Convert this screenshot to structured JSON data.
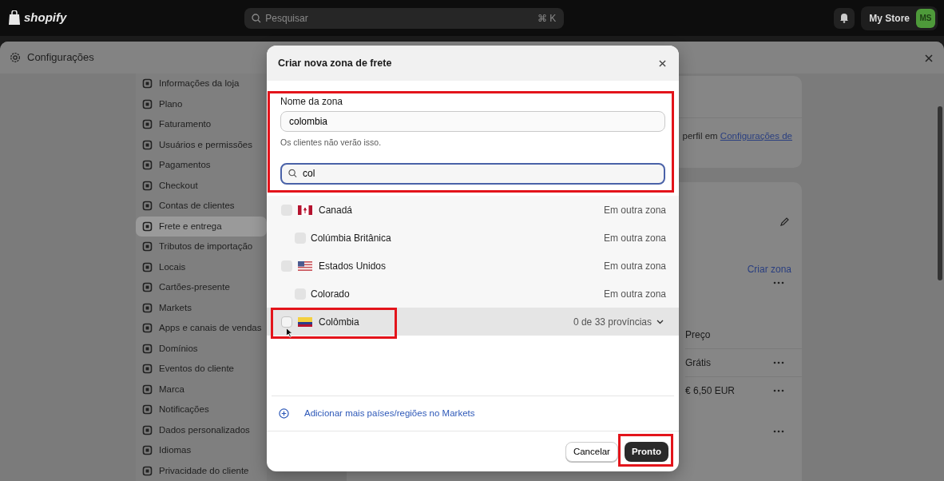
{
  "topbar": {
    "logo": "shopify",
    "search": {
      "placeholder": "Pesquisar",
      "shortcut": "⌘ K"
    },
    "store": "My Store",
    "avatar": "MS"
  },
  "settings": {
    "title": "Configurações"
  },
  "sidebar": {
    "items": [
      {
        "label": "Informações da loja",
        "selected": false
      },
      {
        "label": "Plano",
        "selected": false
      },
      {
        "label": "Faturamento",
        "selected": false
      },
      {
        "label": "Usuários e permissões",
        "selected": false
      },
      {
        "label": "Pagamentos",
        "selected": false
      },
      {
        "label": "Checkout",
        "selected": false
      },
      {
        "label": "Contas de clientes",
        "selected": false
      },
      {
        "label": "Frete e entrega",
        "selected": true
      },
      {
        "label": "Tributos de importação",
        "selected": false
      },
      {
        "label": "Locais",
        "selected": false
      },
      {
        "label": "Cartões-presente",
        "selected": false
      },
      {
        "label": "Markets",
        "selected": false
      },
      {
        "label": "Apps e canais de vendas",
        "selected": false
      },
      {
        "label": "Domínios",
        "selected": false
      },
      {
        "label": "Eventos do cliente",
        "selected": false
      },
      {
        "label": "Marca",
        "selected": false
      },
      {
        "label": "Notificações",
        "selected": false
      },
      {
        "label": "Dados personalizados",
        "selected": false
      },
      {
        "label": "Idiomas",
        "selected": false
      },
      {
        "label": "Privacidade do cliente",
        "selected": false
      }
    ]
  },
  "content": {
    "profile_note": {
      "text": "perfil em",
      "link": "Configurações de"
    },
    "create_zone": "Criar zona",
    "rates": {
      "header": "Preço",
      "rows": [
        "Grátis",
        "€ 6,50 EUR"
      ]
    }
  },
  "modal": {
    "title": "Criar nova zona de frete",
    "zone_name": {
      "label": "Nome da zona",
      "value": "colombia",
      "help": "Os clientes não verão isso."
    },
    "search": {
      "value": "col"
    },
    "countries": [
      {
        "name": "Canadá",
        "kind": "ca",
        "status": "Em outra zona",
        "checked": false,
        "hovered": false,
        "children": [
          {
            "name": "Colúmbia Britânica",
            "status": "Em outra zona",
            "checked": false
          }
        ]
      },
      {
        "name": "Estados Unidos",
        "kind": "us",
        "status": "Em outra zona",
        "checked": false,
        "hovered": false,
        "children": [
          {
            "name": "Colorado",
            "status": "Em outra zona",
            "checked": false
          }
        ]
      },
      {
        "name": "Colômbia",
        "kind": "co",
        "status": "0 de 33 províncias",
        "expandable": true,
        "checked": false,
        "hovered": true
      }
    ],
    "add_link": "Adicionar mais países/regiões no Markets",
    "buttons": [
      {
        "label": "Cancelar",
        "kind": "secondary"
      },
      {
        "label": "Pronto",
        "kind": "primary"
      }
    ]
  }
}
